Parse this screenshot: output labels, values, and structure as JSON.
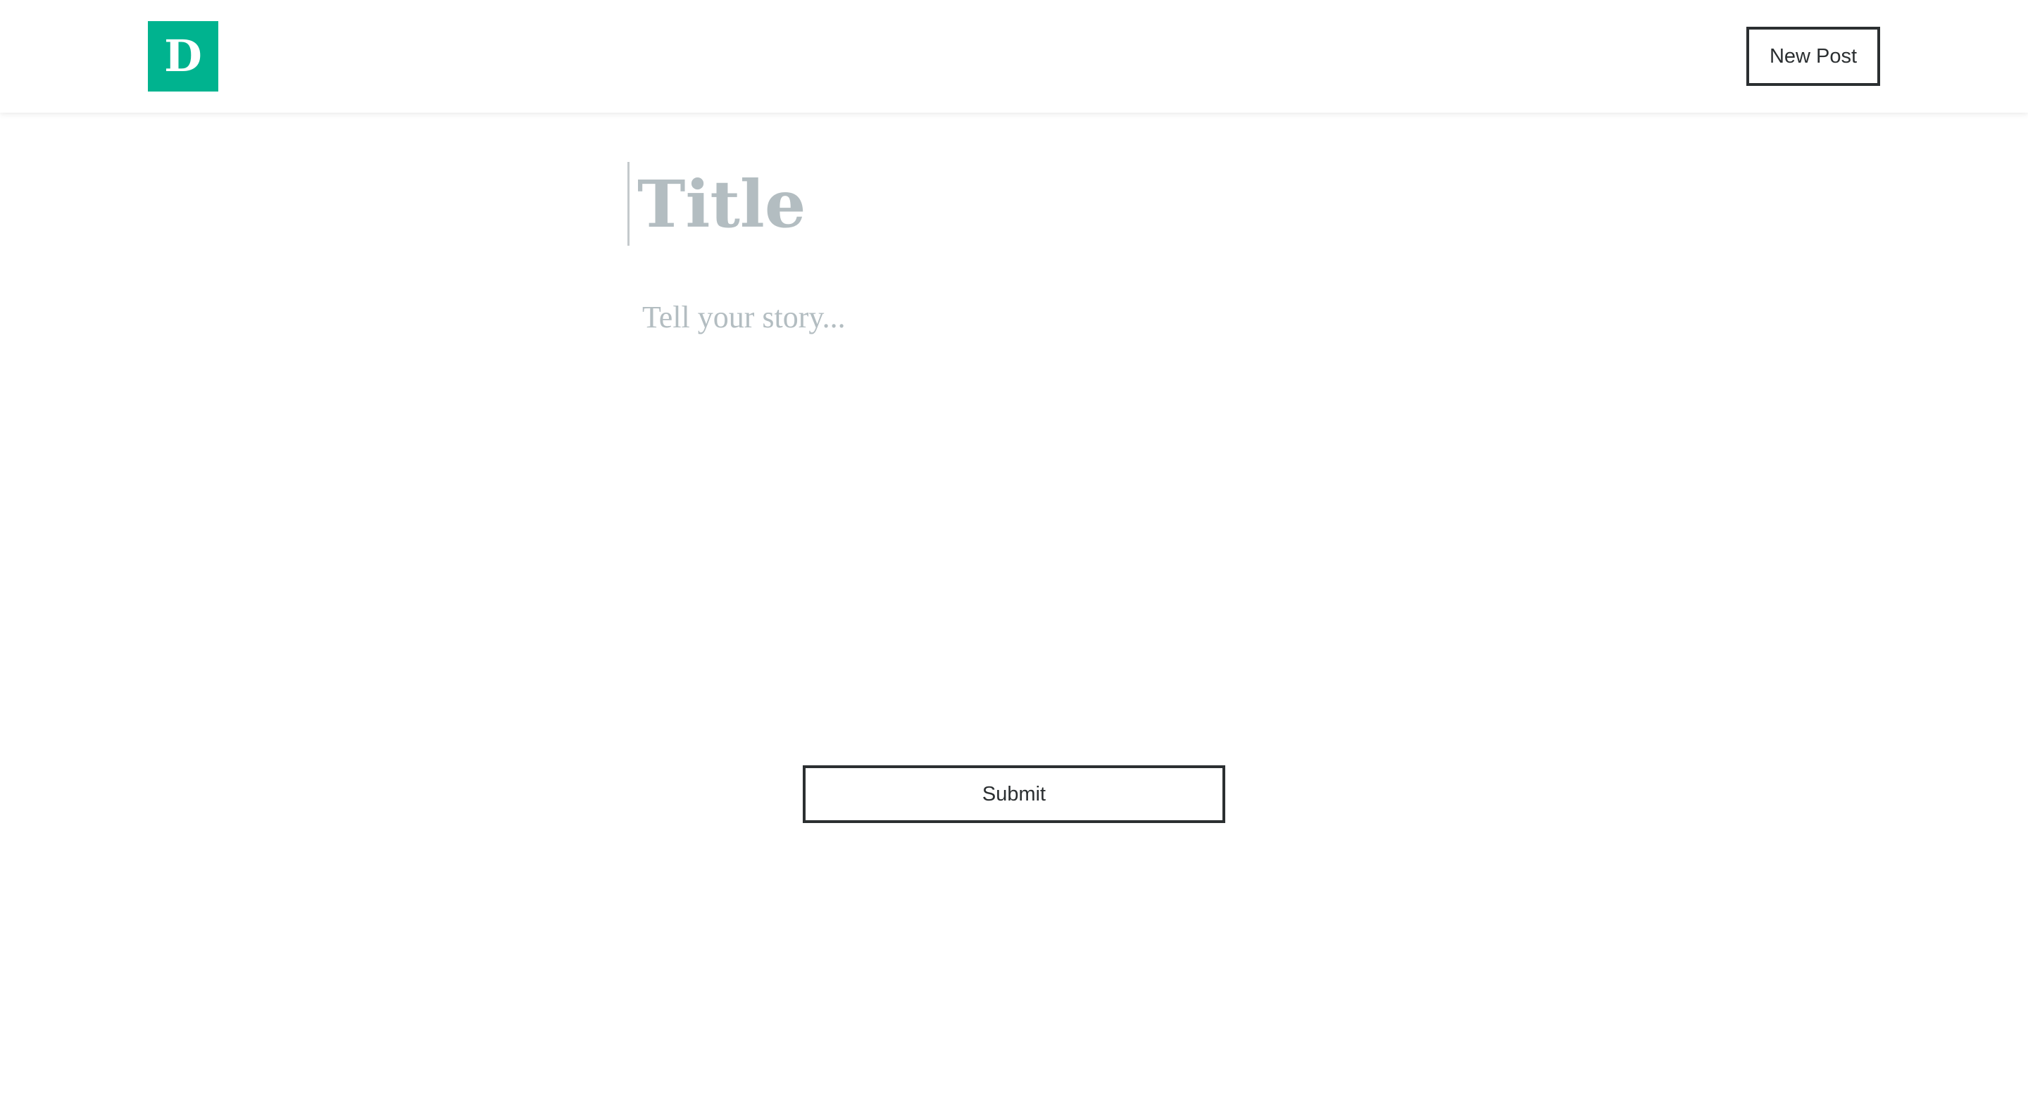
{
  "header": {
    "logo_letter": "D",
    "new_post_label": "New Post"
  },
  "editor": {
    "title_placeholder": "Title",
    "title_value": "",
    "story_placeholder": "Tell your story...",
    "story_value": ""
  },
  "actions": {
    "submit_label": "Submit"
  },
  "colors": {
    "brand": "#00b38f",
    "text": "#2b2f31",
    "placeholder": "#b3bdc1",
    "background": "#ffffff"
  }
}
